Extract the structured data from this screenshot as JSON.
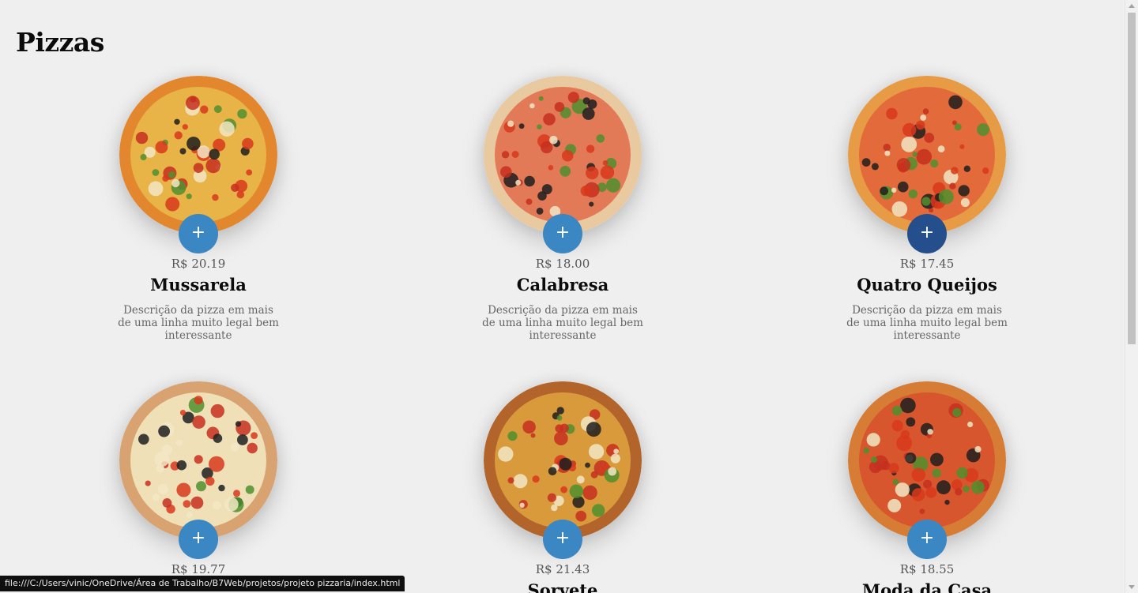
{
  "page": {
    "title": "Pizzas"
  },
  "pizzas": [
    {
      "name": "Mussarela",
      "price": "R$ 20.19",
      "description": "Descrição da pizza em mais de uma linha muito legal bem interessante",
      "add_label": "+",
      "crust_color": "#e2872e",
      "sauce_color": "#e8b347"
    },
    {
      "name": "Calabresa",
      "price": "R$ 18.00",
      "description": "Descrição da pizza em mais de uma linha muito legal bem interessante",
      "add_label": "+",
      "crust_color": "#e9c9a0",
      "sauce_color": "#e37a57"
    },
    {
      "name": "Quatro Queijos",
      "price": "R$ 17.45",
      "description": "Descrição da pizza em mais de uma linha muito legal bem interessante",
      "add_label": "+",
      "crust_color": "#e79b45",
      "sauce_color": "#e26a3b"
    },
    {
      "name": "",
      "price": "R$ 19.77",
      "description": "",
      "add_label": "+",
      "crust_color": "#d9a271",
      "sauce_color": "#efe0b8"
    },
    {
      "name": "Sorvete",
      "price": "R$ 21.43",
      "description": "",
      "add_label": "+",
      "crust_color": "#b3642b",
      "sauce_color": "#d99a3c"
    },
    {
      "name": "Moda da Casa",
      "price": "R$ 18.55",
      "description": "",
      "add_label": "+",
      "crust_color": "#d67c35",
      "sauce_color": "#d8562d"
    }
  ],
  "status_bar": {
    "url": "file:///C:/Users/vinic/OneDrive/Área de Trabalho/B7Web/projetos/projeto pizzaria/index.html"
  },
  "colors": {
    "background": "#efefef",
    "add_button": "#3a87c4",
    "add_button_hover": "#254f8c"
  }
}
